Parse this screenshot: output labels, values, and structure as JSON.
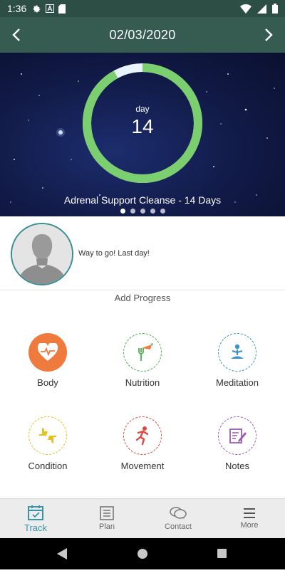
{
  "status": {
    "time": "1:36"
  },
  "header": {
    "date": "02/03/2020"
  },
  "hero": {
    "day_label": "day",
    "day_number": "14",
    "plan_title": "Adrenal Support Cleanse - 14 Days",
    "progress_fraction": 0.92,
    "carousel_pages": 5,
    "carousel_active": 1
  },
  "profile": {
    "message": "Way to go! Last day!"
  },
  "add_progress": {
    "title": "Add Progress",
    "tiles": [
      {
        "label": "Body",
        "icon": "heart-pulse-icon",
        "color": "#ee7a3d"
      },
      {
        "label": "Nutrition",
        "icon": "fork-carrot-icon",
        "color": "#4caf50"
      },
      {
        "label": "Meditation",
        "icon": "meditation-icon",
        "color": "#3a94c6"
      },
      {
        "label": "Condition",
        "icon": "thumbs-up-down-icon",
        "color": "#e6c21e"
      },
      {
        "label": "Movement",
        "icon": "running-icon",
        "color": "#e0463f"
      },
      {
        "label": "Notes",
        "icon": "notes-pencil-icon",
        "color": "#9b59b6"
      }
    ]
  },
  "bottom_nav": {
    "items": [
      {
        "label": "Track",
        "icon": "calendar-check-icon",
        "active": true
      },
      {
        "label": "Plan",
        "icon": "list-icon",
        "active": false
      },
      {
        "label": "Contact",
        "icon": "chat-bubbles-icon",
        "active": false
      },
      {
        "label": "More",
        "icon": "hamburger-icon",
        "active": false
      }
    ]
  },
  "colors": {
    "header": "#365c52",
    "status": "#2d4e44",
    "accent": "#3a94a6",
    "ring": "#7ccf6e"
  }
}
